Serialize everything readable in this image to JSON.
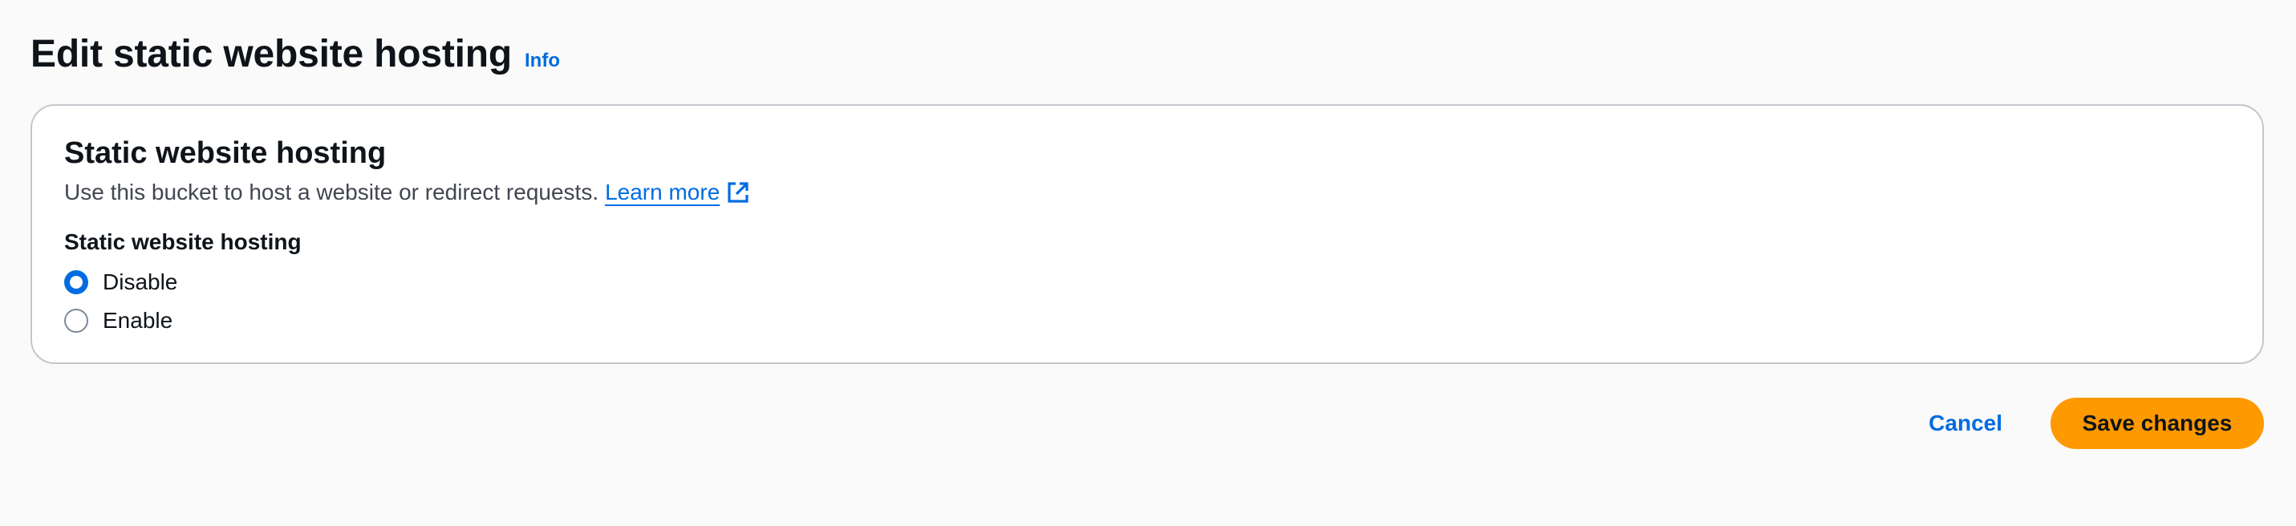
{
  "header": {
    "title": "Edit static website hosting",
    "info_label": "Info"
  },
  "section": {
    "title": "Static website hosting",
    "description": "Use this bucket to host a website or redirect requests.",
    "learn_more_label": "Learn more",
    "learn_more_icon": "external-link-icon",
    "field_label": "Static website hosting",
    "options": [
      {
        "label": "Disable",
        "selected": true
      },
      {
        "label": "Enable",
        "selected": false
      }
    ]
  },
  "actions": {
    "cancel_label": "Cancel",
    "save_label": "Save changes"
  },
  "colors": {
    "accent": "#006ce0",
    "primary_button": "#ff9900",
    "background": "#fafafa",
    "border": "#c6c6cd"
  }
}
